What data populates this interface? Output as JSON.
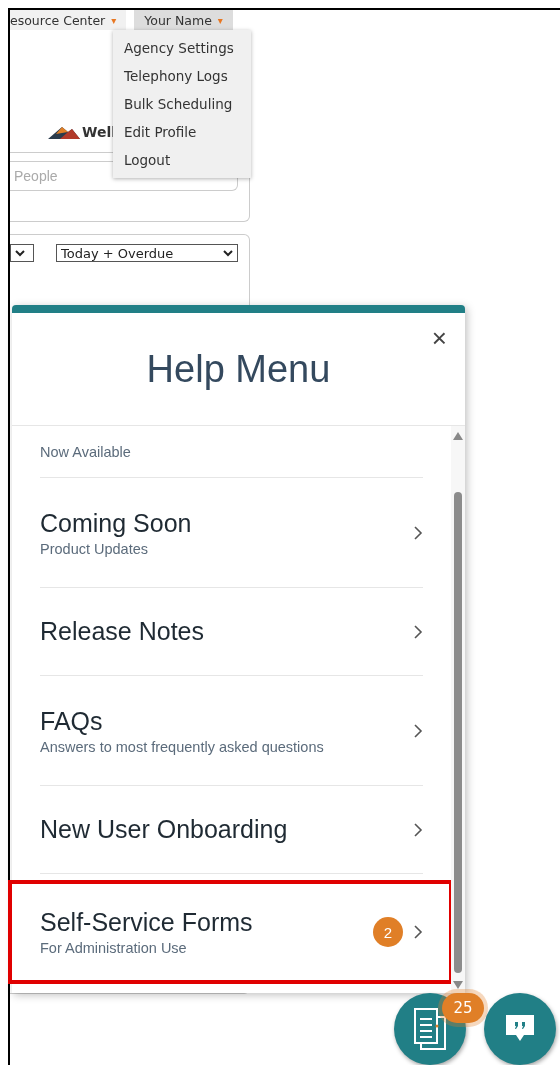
{
  "nav": [
    {
      "label": "esource Center",
      "caret": "▾",
      "open": false
    },
    {
      "label": "Your Name",
      "caret": "▾",
      "open": true
    }
  ],
  "user_menu": [
    "Agency Settings",
    "Telephony Logs",
    "Bulk Scheduling",
    "Edit Profile",
    "Logout"
  ],
  "logo": {
    "text": "Well"
  },
  "search": {
    "placeholder": "People"
  },
  "filters": [
    {
      "kind": "cut"
    },
    {
      "kind": "select",
      "value": "Today + Overdue"
    }
  ],
  "help_menu": {
    "title": "Help Menu",
    "close": "×",
    "items": [
      {
        "subtitle": "Now Available",
        "highlighted": false
      },
      {
        "title": "Coming Soon",
        "subtitle": "Product Updates",
        "highlighted": false
      },
      {
        "title": "Release Notes",
        "highlighted": false
      },
      {
        "title": "FAQs",
        "subtitle": "Answers to most frequently asked questions",
        "highlighted": false
      },
      {
        "title": "New User Onboarding",
        "highlighted": false
      },
      {
        "title": "Self-Service Forms",
        "subtitle": "For Administration Use",
        "badge": "2",
        "highlighted": true
      }
    ]
  },
  "fabs": [
    {
      "kind": "document",
      "badge": "25"
    },
    {
      "kind": "chat"
    }
  ]
}
